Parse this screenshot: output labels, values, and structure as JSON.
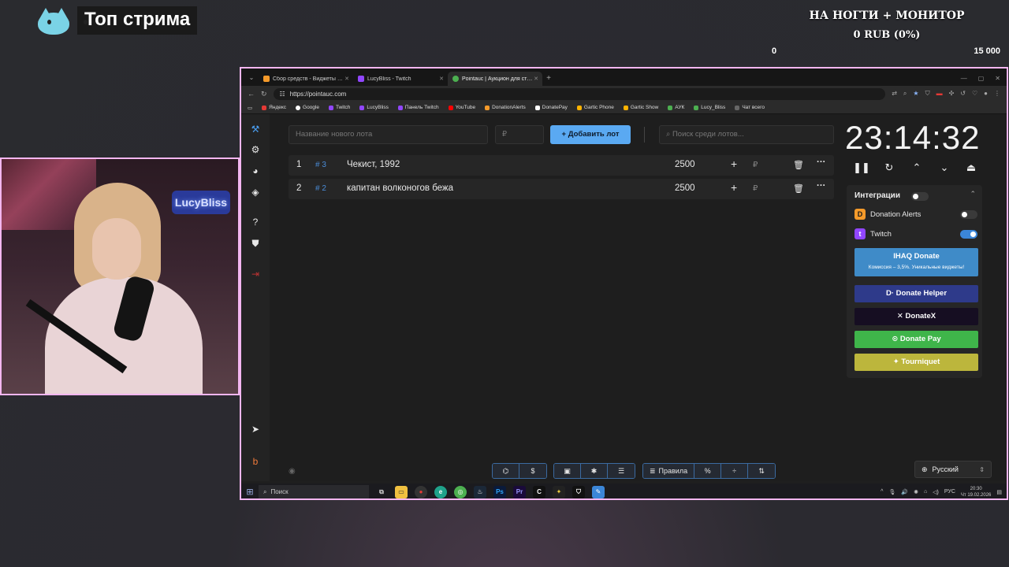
{
  "overlay": {
    "title": "Топ стрима",
    "goal_title": "НА НОГТИ + МОНИТОР",
    "goal_amount": "0 RUB (0%)",
    "goal_min": "0",
    "goal_max": "15 000",
    "cam_neon_text": "LucyBliss"
  },
  "browser": {
    "tabs": [
      {
        "label": "Сбор средств - Виджеты - Donat",
        "color": "#f59a2a",
        "active": false
      },
      {
        "label": "LucyBliss - Twitch",
        "color": "#9146ff",
        "active": false
      },
      {
        "label": "Pointauc | Аукцион для стример",
        "color": "#4caf50",
        "active": true
      }
    ],
    "url": "https://pointauc.com",
    "bookmarks": [
      {
        "label": "Яндекс",
        "color": "#e53935"
      },
      {
        "label": "Google",
        "color": "#ffffff"
      },
      {
        "label": "Twitch",
        "color": "#9146ff"
      },
      {
        "label": "LucyBliss",
        "color": "#9146ff"
      },
      {
        "label": "Панель Twitch",
        "color": "#9146ff"
      },
      {
        "label": "YouTube",
        "color": "#ff0000"
      },
      {
        "label": "DonationAlerts",
        "color": "#f59a2a"
      },
      {
        "label": "DonatePay",
        "color": "#ffffff"
      },
      {
        "label": "Gartic Phone",
        "color": "#ffb300"
      },
      {
        "label": "Gartic Show",
        "color": "#ffb300"
      },
      {
        "label": "АУК",
        "color": "#4caf50"
      },
      {
        "label": "Lucy_Bliss",
        "color": "#4caf50"
      },
      {
        "label": "Чат всего",
        "color": "#666666"
      }
    ]
  },
  "app": {
    "new_lot_placeholder": "Название нового лота",
    "amount_placeholder": "₽",
    "add_lot_label": "Добавить лот",
    "search_placeholder": "Поиск среди лотов...",
    "lots": [
      {
        "num": "1",
        "id": "# 3",
        "name": "Чекист, 1992",
        "amount": "2500"
      },
      {
        "num": "2",
        "id": "# 2",
        "name": "капитан волконогов бежа",
        "amount": "2500"
      }
    ],
    "currency_symbol": "₽",
    "timer": "23:14:32",
    "integrations": {
      "title": "Интеграции",
      "enabled": false,
      "items": [
        {
          "label": "Donation Alerts",
          "enabled": false
        },
        {
          "label": "Twitch",
          "enabled": true
        }
      ]
    },
    "services": [
      {
        "label": "IHAQ Donate",
        "sub": "Комиссия – 3,5%. Уникальные виджеты!",
        "color": "#3f8bc8"
      },
      {
        "label": "Donate Helper",
        "color": "#2e3a8a"
      },
      {
        "label": "DonateX",
        "color": "#160e22"
      },
      {
        "label": "Donate Pay",
        "color": "#3fb54a"
      },
      {
        "label": "Tourniquet",
        "color": "#bcb63c"
      }
    ],
    "bottom_rules": "Правила",
    "language": "Русский"
  },
  "taskbar": {
    "search": "Поиск",
    "lang": "РУС",
    "time": "20:30",
    "date": "Чт 19.02.2026"
  }
}
